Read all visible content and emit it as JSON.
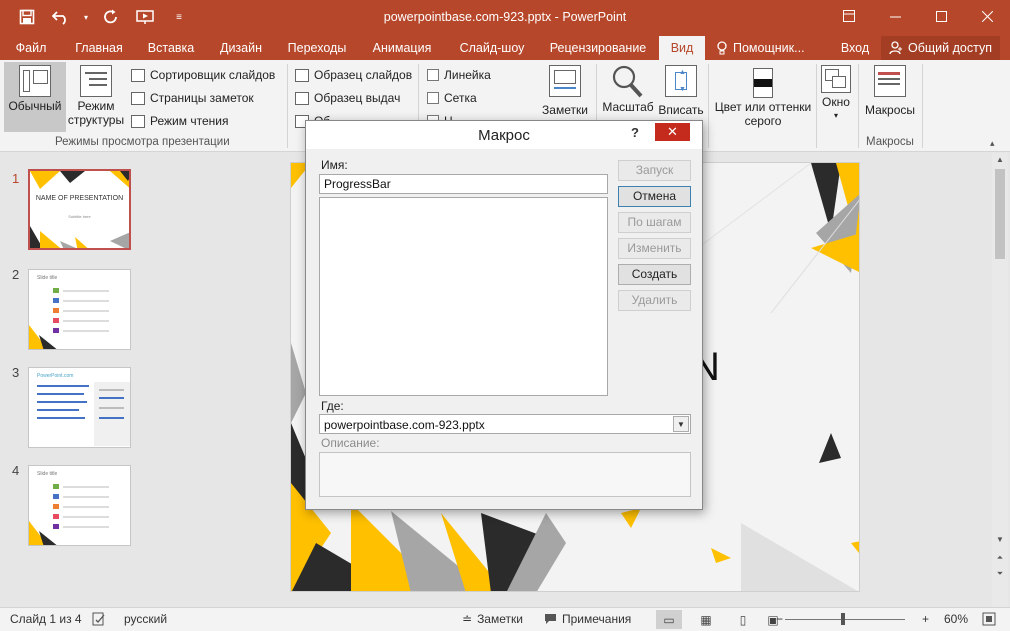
{
  "window": {
    "title": "powerpointbase.com-923.pptx - PowerPoint",
    "qat": [
      "save-icon",
      "undo-icon",
      "redo-icon",
      "present-icon",
      "customize-icon"
    ],
    "controls": [
      "ribbon-display-icon",
      "minimize-icon",
      "maximize-icon",
      "close-icon"
    ]
  },
  "tabs": {
    "file": "Файл",
    "home": "Главная",
    "insert": "Вставка",
    "design": "Дизайн",
    "transitions": "Переходы",
    "animation": "Анимация",
    "slideshow": "Слайд-шоу",
    "review": "Рецензирование",
    "view": "Вид",
    "tellme": "Помощник...",
    "signin": "Вход",
    "share": "Общий доступ"
  },
  "ribbon": {
    "normal": "Обычный",
    "outline_1": "Режим",
    "outline_2": "структуры",
    "sorter": "Сортировщик слайдов",
    "notes_page": "Страницы заметок",
    "reading": "Режим чтения",
    "group_views": "Режимы просмотра презентации",
    "slide_master": "Образец слайдов",
    "handout_master": "Образец выдач",
    "notes_master": "Об",
    "ruler": "Линейка",
    "grid": "Сетка",
    "guides": "Н",
    "notes": "Заметки",
    "zoom": "Масштаб",
    "fit": "Вписать",
    "color_1": "Цвет или оттенки",
    "color_2": "серого",
    "window": "Окно",
    "macros": "Макросы",
    "group_macros": "Макросы"
  },
  "thumbnails": [
    {
      "num": "1",
      "title": "NAME OF PRESENTATION",
      "subtitle": "Subtitle here"
    },
    {
      "num": "2",
      "title": "Slide title"
    },
    {
      "num": "3",
      "title": "PowerPoint.com"
    },
    {
      "num": "4",
      "title": "Slide title"
    }
  ],
  "slide": {
    "visible_letter": "N"
  },
  "dialog": {
    "title": "Макрос",
    "help": "?",
    "close": "✕",
    "name_label": "Имя:",
    "name_value": "ProgressBar",
    "where_label": "Где:",
    "where_value": "powerpointbase.com-923.pptx",
    "desc_label": "Описание:",
    "buttons": {
      "run": "Запуск",
      "cancel": "Отмена",
      "step": "По шагам",
      "edit": "Изменить",
      "create": "Создать",
      "delete": "Удалить"
    }
  },
  "status": {
    "slide": "Слайд 1 из 4",
    "language": "русский",
    "notes": "Заметки",
    "comments": "Примечания",
    "zoom": "60%"
  },
  "colors": {
    "accent": "#b7472a",
    "slide_yellow": "#ffc000",
    "slide_dark": "#2b2b2b",
    "slide_gray": "#a6a6a6"
  }
}
